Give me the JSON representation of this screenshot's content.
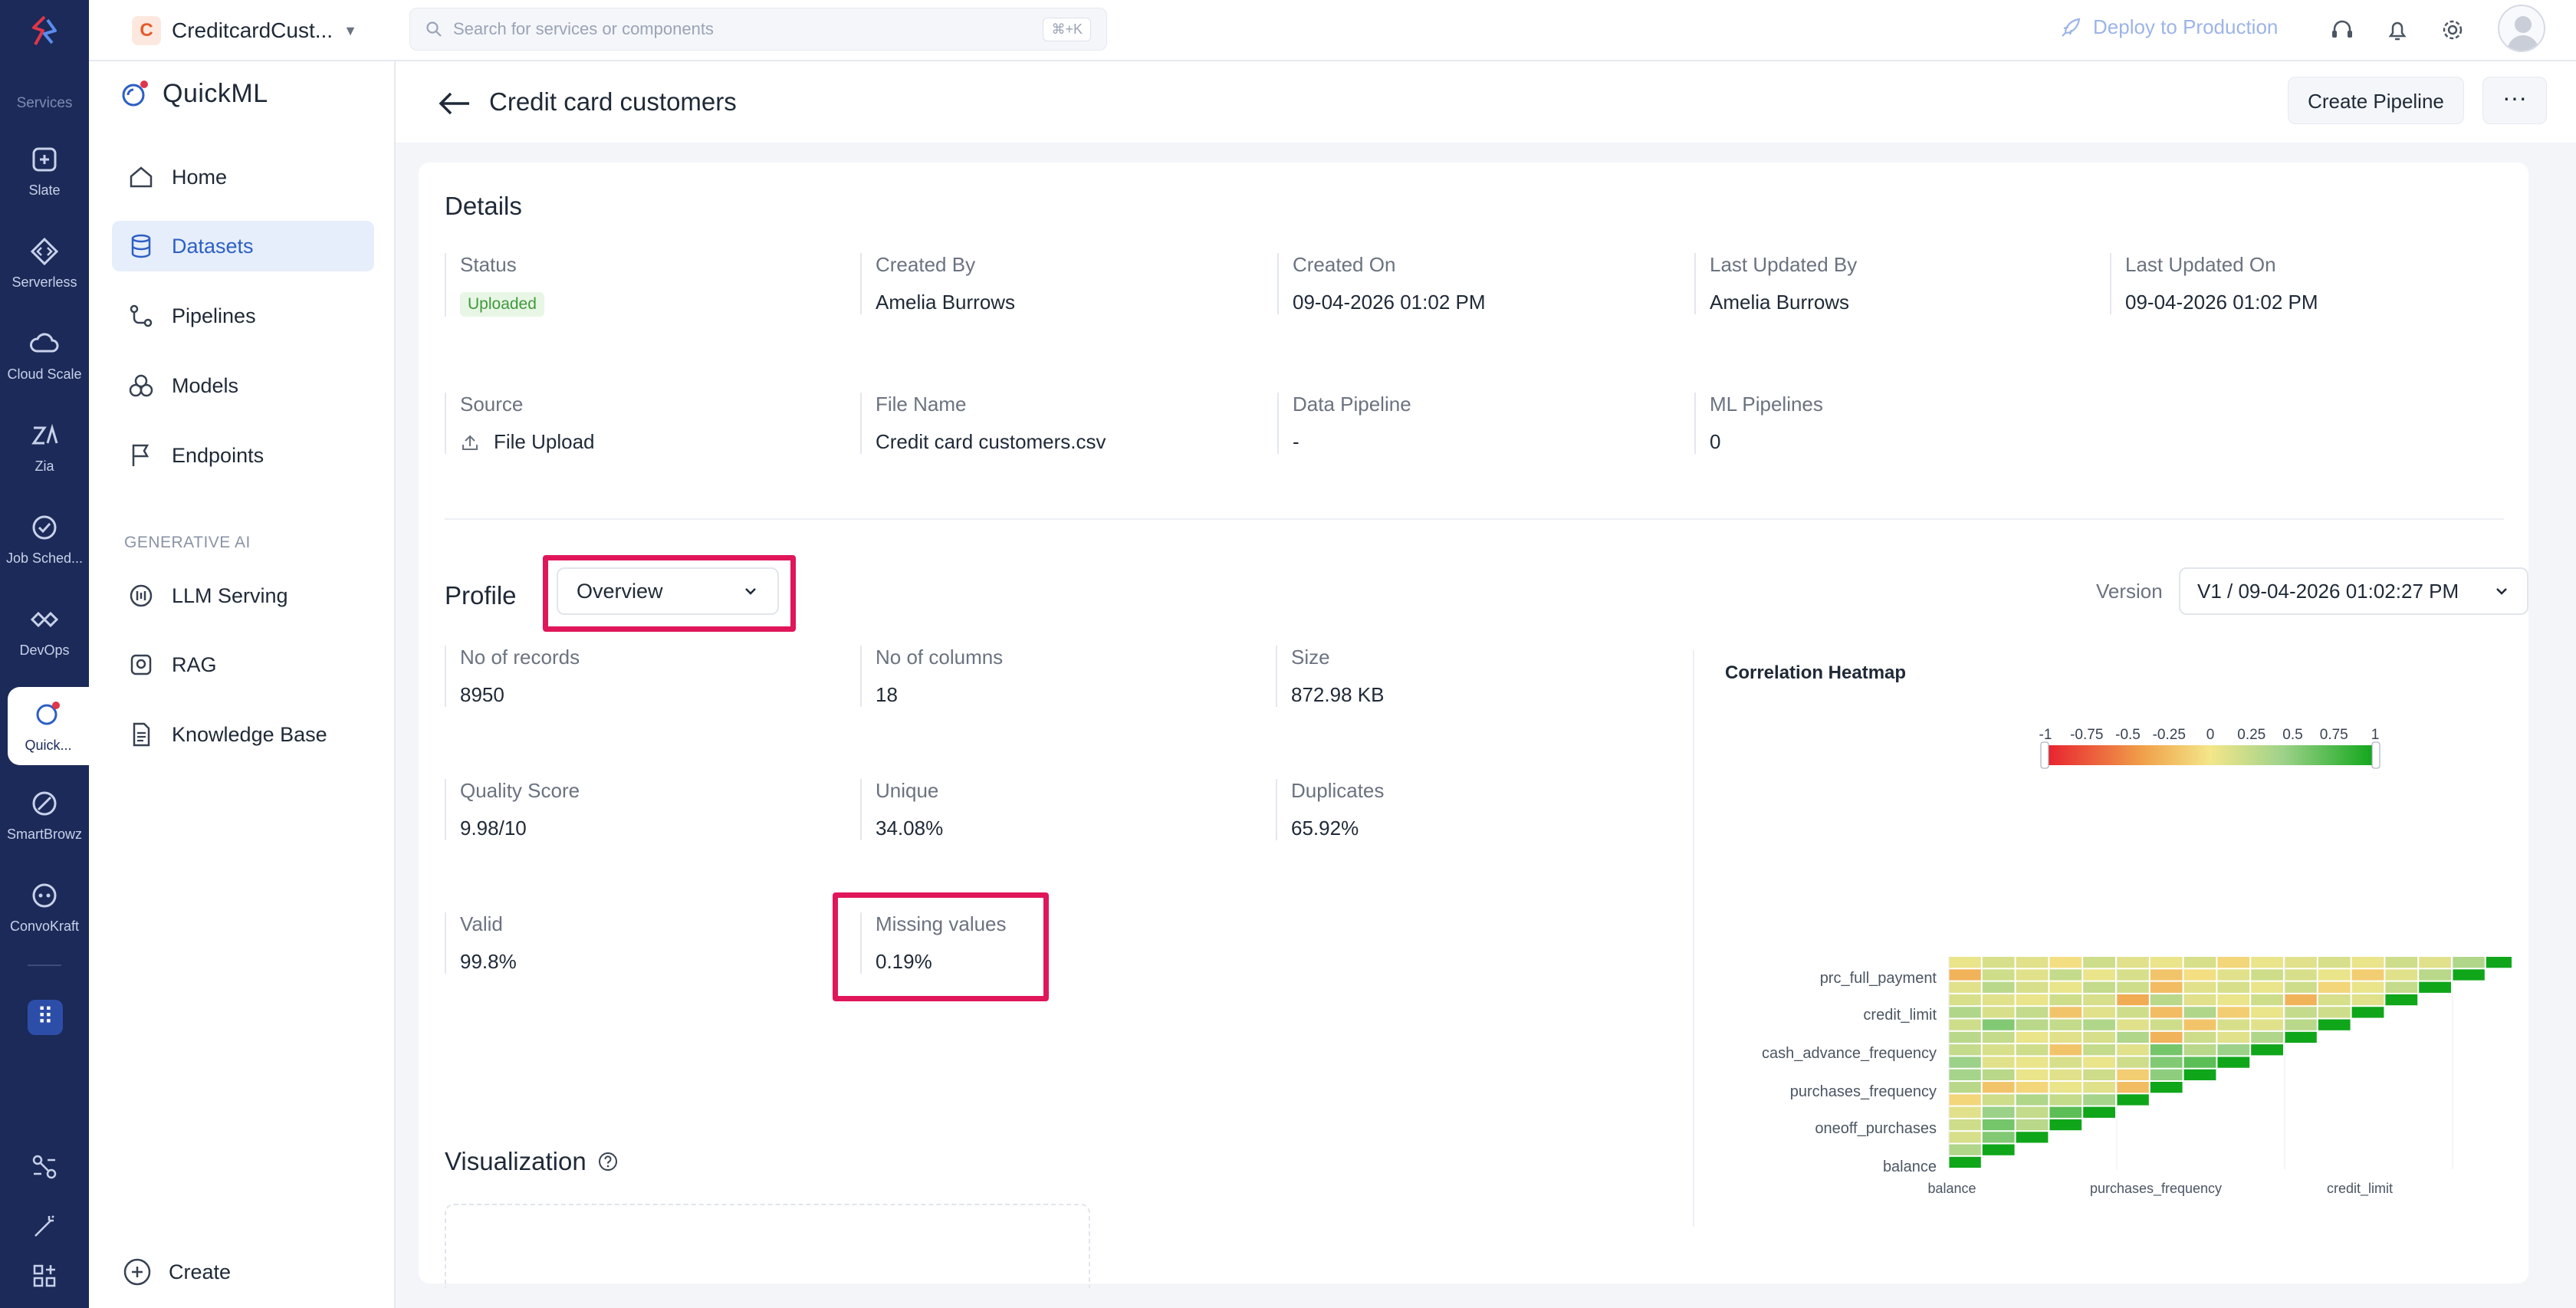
{
  "rail": {
    "services_label": "Services",
    "items": [
      {
        "label": "Slate",
        "icon": "slate-icon"
      },
      {
        "label": "Serverless",
        "icon": "code-icon"
      },
      {
        "label": "Cloud Scale",
        "icon": "cloud-icon"
      },
      {
        "label": "Zia",
        "icon": "zia-icon"
      },
      {
        "label": "Job Sched...",
        "icon": "clock-check-icon"
      },
      {
        "label": "DevOps",
        "icon": "devops-icon"
      },
      {
        "label": "Quick...",
        "icon": "quickml-icon"
      },
      {
        "label": "SmartBrowz",
        "icon": "browser-icon"
      },
      {
        "label": "ConvoKraft",
        "icon": "chatbot-icon"
      }
    ]
  },
  "topbar": {
    "project_initial": "C",
    "project_name": "CreditcardCust...",
    "search_placeholder": "Search for services or components",
    "search_shortcut": "⌘+K",
    "deploy_label": "Deploy to Production"
  },
  "sidebar": {
    "brand": "QuickML",
    "items": [
      {
        "label": "Home"
      },
      {
        "label": "Datasets"
      },
      {
        "label": "Pipelines"
      },
      {
        "label": "Models"
      },
      {
        "label": "Endpoints"
      }
    ],
    "section_title": "GENERATIVE AI",
    "genai_items": [
      {
        "label": "LLM Serving"
      },
      {
        "label": "RAG"
      },
      {
        "label": "Knowledge Base"
      }
    ],
    "create_label": "Create"
  },
  "header": {
    "title": "Credit card customers",
    "create_pipeline": "Create Pipeline",
    "more": "···"
  },
  "details": {
    "title": "Details",
    "status_label": "Status",
    "status_value": "Uploaded",
    "created_by_label": "Created By",
    "created_by_value": "Amelia Burrows",
    "created_on_label": "Created On",
    "created_on_value": "09-04-2026 01:02 PM",
    "last_updated_by_label": "Last Updated By",
    "last_updated_by_value": "Amelia Burrows",
    "last_updated_on_label": "Last Updated On",
    "last_updated_on_value": "09-04-2026 01:02 PM",
    "source_label": "Source",
    "source_value": "File Upload",
    "file_name_label": "File Name",
    "file_name_value": "Credit card customers.csv",
    "data_pipeline_label": "Data Pipeline",
    "data_pipeline_value": "-",
    "ml_pipelines_label": "ML Pipelines",
    "ml_pipelines_value": "0"
  },
  "profile": {
    "title": "Profile",
    "view_selected": "Overview",
    "version_label": "Version",
    "version_selected": "V1 / 09-04-2026 01:02:27 PM",
    "stats": {
      "records_label": "No of records",
      "records_value": "8950",
      "columns_label": "No of columns",
      "columns_value": "18",
      "size_label": "Size",
      "size_value": "872.98 KB",
      "quality_label": "Quality Score",
      "quality_value": "9.98/10",
      "unique_label": "Unique",
      "unique_value": "34.08%",
      "duplicates_label": "Duplicates",
      "duplicates_value": "65.92%",
      "valid_label": "Valid",
      "valid_value": "99.8%",
      "missing_label": "Missing values",
      "missing_value": "0.19%"
    }
  },
  "heatmap": {
    "title": "Correlation Heatmap",
    "colors": [
      "#e8202f",
      "#f0a24a",
      "#f4e68a",
      "#9ed28a",
      "#0fa619"
    ],
    "scale_ticks": [
      "-1",
      "-0.75",
      "-0.5",
      "-0.25",
      "0",
      "0.25",
      "0.5",
      "0.75",
      "1"
    ],
    "y_labels": [
      "prc_full_payment",
      "credit_limit",
      "cash_advance_frequency",
      "purchases_frequency",
      "oneoff_purchases",
      "balance"
    ],
    "x_labels": [
      "balance",
      "purchases_frequency",
      "credit_limit"
    ]
  },
  "chart_data": {
    "type": "heatmap",
    "title": "Correlation Heatmap",
    "color_scale_range": [
      -1,
      1
    ],
    "n_variables": 17,
    "labeled_rows_bottom_to_top": [
      "balance",
      "oneoff_purchases",
      "purchases_frequency",
      "cash_advance_frequency",
      "credit_limit",
      "prc_full_payment"
    ],
    "labeled_columns": [
      "balance",
      "purchases_frequency",
      "credit_limit"
    ],
    "diagonal_value": 1,
    "note_values_sampled": [
      [
        1.0
      ],
      [
        0.35,
        1.0
      ],
      [
        0.15,
        0.55,
        1.0
      ],
      [
        0.2,
        0.6,
        0.3,
        1.0
      ],
      [
        0.1,
        0.45,
        0.25,
        0.7,
        1.0
      ],
      [
        -0.1,
        0.2,
        0.35,
        0.25,
        0.4,
        1.0
      ],
      [
        0.3,
        -0.2,
        -0.1,
        0.05,
        0.1,
        -0.25,
        1.0
      ],
      [
        0.4,
        0.3,
        0.05,
        0.1,
        0.2,
        -0.15,
        0.5,
        1.0
      ],
      [
        0.45,
        0.1,
        0.05,
        0.15,
        0.05,
        0.2,
        0.55,
        0.7,
        1.0
      ],
      [
        0.25,
        0.15,
        0.2,
        -0.2,
        0.25,
        0.1,
        0.6,
        0.3,
        0.45,
        1.0
      ],
      [
        0.3,
        0.25,
        0.05,
        0.1,
        0.15,
        0.35,
        -0.3,
        0.2,
        0.1,
        0.35,
        1.0
      ],
      [
        0.2,
        0.55,
        0.3,
        0.25,
        0.35,
        0.1,
        0.2,
        -0.2,
        0.15,
        0.1,
        0.3,
        1.0
      ],
      [
        0.35,
        0.15,
        0.25,
        -0.2,
        0.1,
        0.2,
        -0.25,
        0.35,
        -0.15,
        0.05,
        0.25,
        0.2,
        1.0
      ],
      [
        0.15,
        0.1,
        0.05,
        0.2,
        0.15,
        -0.35,
        0.3,
        0.1,
        0.05,
        0.2,
        -0.3,
        0.15,
        0.1,
        1.0
      ],
      [
        0.1,
        0.3,
        0.15,
        0.05,
        0.25,
        0.2,
        -0.25,
        0.1,
        0.15,
        0.05,
        0.2,
        -0.1,
        0.05,
        0.25,
        1.0
      ],
      [
        -0.3,
        0.2,
        0.1,
        0.25,
        0.05,
        0.15,
        -0.2,
        -0.05,
        0.1,
        0.2,
        0.15,
        0.05,
        -0.15,
        0.1,
        0.3,
        1.0
      ],
      [
        0.05,
        0.15,
        0.1,
        -0.05,
        0.2,
        0.1,
        0.05,
        0.15,
        -0.1,
        0.05,
        0.1,
        0.15,
        0.05,
        0.2,
        0.1,
        0.35,
        1.0
      ]
    ]
  },
  "visualization": {
    "title": "Visualization"
  }
}
